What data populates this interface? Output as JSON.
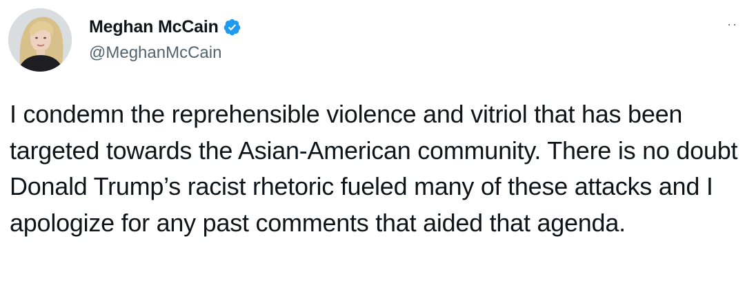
{
  "author": {
    "display_name": "Meghan McCain",
    "handle": "@MeghanMcCain",
    "verified_icon": "verified-badge-icon",
    "avatar_icon": "profile-photo"
  },
  "menu": {
    "more_glyph": "··",
    "more_icon": "more-options-icon"
  },
  "tweet": {
    "text": "I condemn the reprehensible violence and vitriol that has been targeted towards the Asian-American community. There is no doubt Donald Trump’s racist rhetoric fueled many of these attacks and I apologize for any past comments that aided that agenda."
  },
  "colors": {
    "verified_blue": "#1d9bf0",
    "text_primary": "#0f1419",
    "text_secondary": "#536471"
  }
}
